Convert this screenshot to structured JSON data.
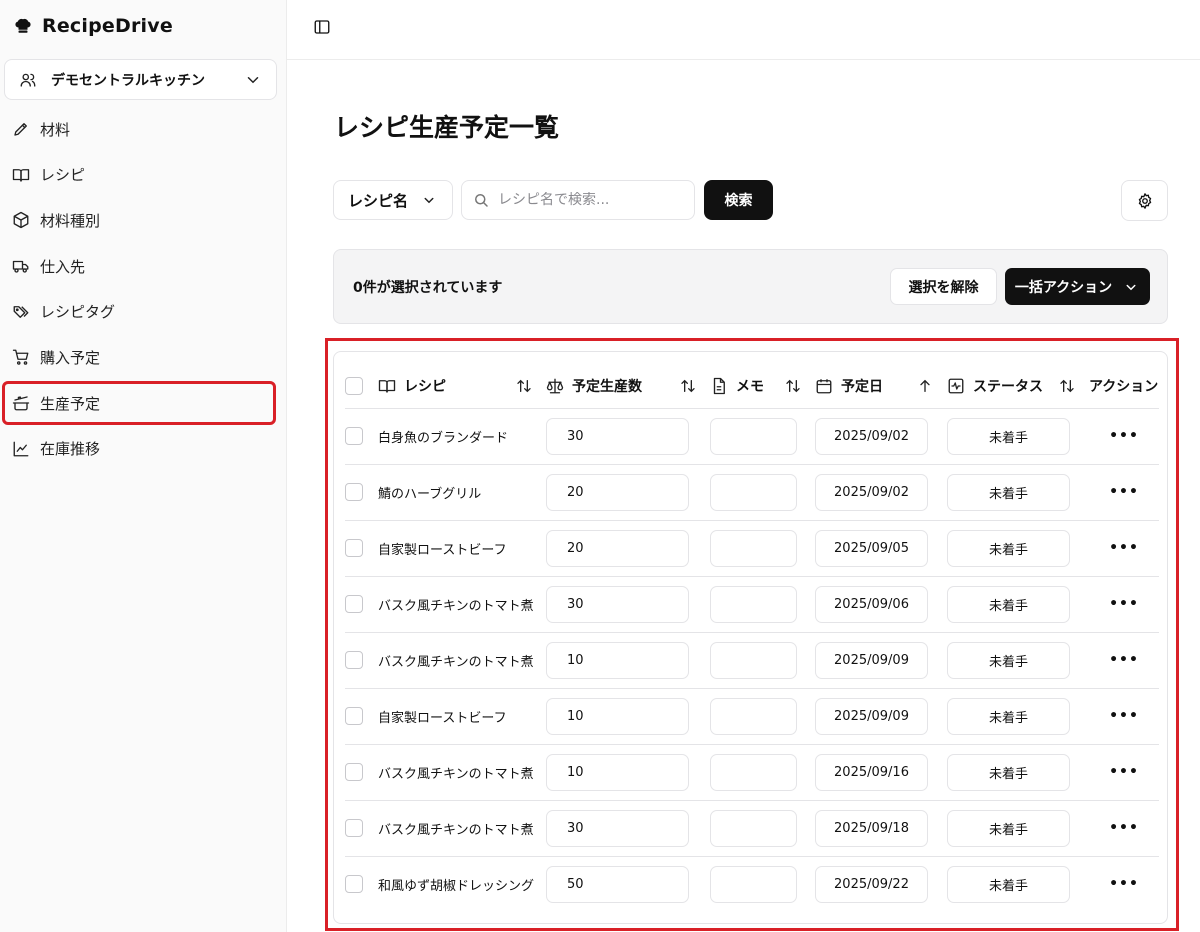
{
  "app": {
    "name": "RecipeDrive"
  },
  "org": {
    "name": "デモセントラルキッチン"
  },
  "sidebar": {
    "items": [
      {
        "label": "材料",
        "icon": "pencil-icon",
        "active": false
      },
      {
        "label": "レシピ",
        "icon": "book-open-icon",
        "active": false
      },
      {
        "label": "材料種別",
        "icon": "box-icon",
        "active": false
      },
      {
        "label": "仕入先",
        "icon": "truck-icon",
        "active": false
      },
      {
        "label": "レシピタグ",
        "icon": "tags-icon",
        "active": false
      },
      {
        "label": "購入予定",
        "icon": "cart-icon",
        "active": false
      },
      {
        "label": "生産予定",
        "icon": "cooking-pot-icon",
        "active": true
      },
      {
        "label": "在庫推移",
        "icon": "line-chart-icon",
        "active": false
      }
    ]
  },
  "page": {
    "title": "レシピ生産予定一覧"
  },
  "filter": {
    "field": "レシピ名",
    "placeholder": "レシピ名で検索...",
    "search_label": "検索"
  },
  "selection": {
    "text": "0件が選択されています",
    "clear_label": "選択を解除",
    "bulk_label": "一括アクション"
  },
  "table": {
    "headers": {
      "recipe": "レシピ",
      "quantity": "予定生産数",
      "memo": "メモ",
      "date": "予定日",
      "status": "ステータス",
      "actions": "アクション"
    },
    "rows": [
      {
        "recipe": "白身魚のブランダード",
        "quantity": "30",
        "memo": "",
        "date": "2025/09/02",
        "status": "未着手"
      },
      {
        "recipe": "鯖のハーブグリル",
        "quantity": "20",
        "memo": "",
        "date": "2025/09/02",
        "status": "未着手"
      },
      {
        "recipe": "自家製ローストビーフ",
        "quantity": "20",
        "memo": "",
        "date": "2025/09/05",
        "status": "未着手"
      },
      {
        "recipe": "バスク風チキンのトマト煮",
        "quantity": "30",
        "memo": "",
        "date": "2025/09/06",
        "status": "未着手"
      },
      {
        "recipe": "バスク風チキンのトマト煮",
        "quantity": "10",
        "memo": "",
        "date": "2025/09/09",
        "status": "未着手"
      },
      {
        "recipe": "自家製ローストビーフ",
        "quantity": "10",
        "memo": "",
        "date": "2025/09/09",
        "status": "未着手"
      },
      {
        "recipe": "バスク風チキンのトマト煮",
        "quantity": "10",
        "memo": "",
        "date": "2025/09/16",
        "status": "未着手"
      },
      {
        "recipe": "バスク風チキンのトマト煮",
        "quantity": "30",
        "memo": "",
        "date": "2025/09/18",
        "status": "未着手"
      },
      {
        "recipe": "和風ゆず胡椒ドレッシング",
        "quantity": "50",
        "memo": "",
        "date": "2025/09/22",
        "status": "未着手"
      }
    ],
    "row_action": "•••"
  },
  "colors": {
    "highlight": "#d92027",
    "primary": "#111111",
    "border": "#e4e4e7"
  }
}
